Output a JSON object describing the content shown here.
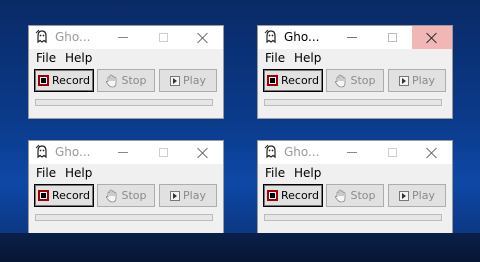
{
  "windows": [
    {
      "title": "Gho...",
      "active": false,
      "menu": {
        "file": "File",
        "help": "Help"
      },
      "buttons": {
        "record": "Record",
        "stop": "Stop",
        "play": "Play"
      },
      "progress": 0
    },
    {
      "title": "Gho...",
      "active": true,
      "menu": {
        "file": "File",
        "help": "Help"
      },
      "buttons": {
        "record": "Record",
        "stop": "Stop",
        "play": "Play"
      },
      "progress": 0
    },
    {
      "title": "Gho...",
      "active": false,
      "menu": {
        "file": "File",
        "help": "Help"
      },
      "buttons": {
        "record": "Record",
        "stop": "Stop",
        "play": "Play"
      },
      "progress": 0
    },
    {
      "title": "Gho...",
      "active": false,
      "menu": {
        "file": "File",
        "help": "Help"
      },
      "buttons": {
        "record": "Record",
        "stop": "Stop",
        "play": "Play"
      },
      "progress": 0
    }
  ],
  "icons": {
    "app": "ghost-app-icon",
    "record": "record-icon",
    "stop": "hand-icon",
    "play": "play-icon",
    "minimize": "minimize-icon",
    "maximize": "maximize-icon",
    "close": "close-icon"
  },
  "colors": {
    "desktop": "#0b3a8a",
    "close_hover": "#f1b7b7",
    "record_border": "#a00000"
  }
}
